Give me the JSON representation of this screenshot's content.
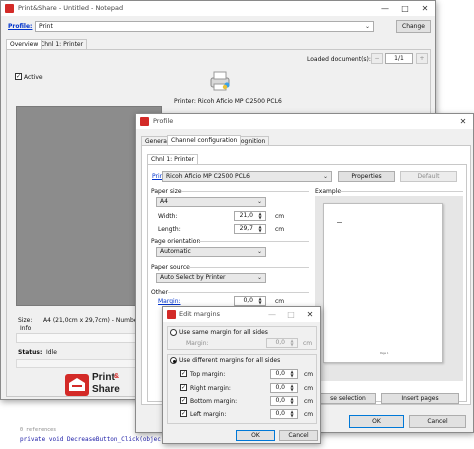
{
  "main_window": {
    "title": "Print&Share - Untitled - Notepad",
    "profile_label": "Profile:",
    "profile_value": "Print",
    "change_button": "Change",
    "tabs": [
      "Overview",
      "Chnl 1: Printer"
    ],
    "loaded_docs_label": "Loaded document(s):",
    "page_counter": "1/1",
    "active_label": "Active",
    "printer_line": "Printer: Ricoh Aficio MP C2500 PCL6",
    "size_label": "Size:",
    "size_value": "A4 (21,0cm x 29,7cm) - Number of c",
    "info_label": "Info",
    "status_label": "Status:",
    "status_value": "Idle",
    "brand_line1": "Print",
    "brand_amp": "&",
    "brand_line2": "Share"
  },
  "code_area": {
    "references": "0 references",
    "line": "private void DecreaseButton_Click(objec"
  },
  "profile_dialog": {
    "title": "Profile",
    "tabs": [
      "General",
      "Channel configuration",
      "Recognition"
    ],
    "subtab": "Chnl 1: Printer",
    "printer_label": "Printer:",
    "printer_value": "Ricoh Aficio MP C2500 PCL6",
    "properties_button": "Properties",
    "default_button": "Default",
    "paper_size_label": "Paper size",
    "paper_size_value": "A4",
    "width_label": "Width:",
    "width_value": "21,0",
    "height_label": "Length:",
    "height_value": "29,7",
    "unit_cm": "cm",
    "orientation_label": "Page orientation",
    "orientation_value": "Automatic",
    "source_label": "Paper source",
    "source_value": "Auto Select by Printer",
    "other_label": "Other",
    "margin_link": "Margin:",
    "margin_value": "0,0",
    "example_label": "Example",
    "page_number_mark": "Page 1",
    "insert_selection_button": "se selection",
    "insert_pages_button": "Insert pages",
    "ok_button": "OK",
    "cancel_button": "Cancel"
  },
  "margins_dialog": {
    "title": "Edit margins",
    "same_margin_label": "Use same margin for all sides",
    "margin_label": "Margin:",
    "margin_value": "0,0",
    "different_label": "Use different margins for all sides",
    "top_label": "Top margin:",
    "top_value": "0,0",
    "right_label": "Right margin:",
    "right_value": "0,0",
    "bottom_label": "Bottom margin:",
    "bottom_value": "0,0",
    "left_label": "Left margin:",
    "left_value": "0,0",
    "unit_cm": "cm",
    "ok_button": "OK",
    "cancel_button": "Cancel"
  }
}
